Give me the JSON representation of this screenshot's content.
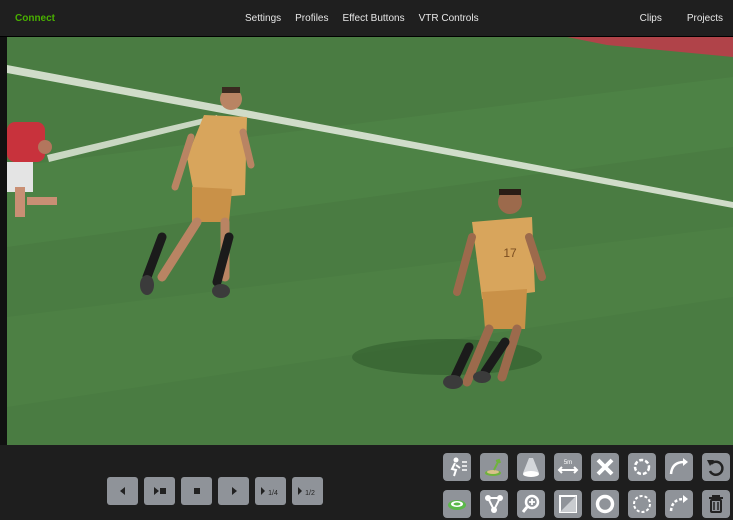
{
  "topbar": {
    "connect_label": "Connect",
    "menu": [
      "Settings",
      "Profiles",
      "Effect Buttons",
      "VTR Controls"
    ],
    "right_menu": [
      "Clips",
      "Projects"
    ]
  },
  "colors": {
    "connect": "#49b000",
    "topbar_bg": "#1f1f1f",
    "button_bg": "#8f9399",
    "pitch": "#4c7f44",
    "jersey": "#d8a55c"
  },
  "players": [
    {
      "number": "17"
    }
  ],
  "transport": {
    "buttons": [
      {
        "name": "step-back",
        "icon": "triangle-left"
      },
      {
        "name": "play-pause",
        "icon": "play-pause"
      },
      {
        "name": "stop",
        "icon": "square"
      },
      {
        "name": "play",
        "icon": "triangle-right"
      },
      {
        "name": "play-quarter-speed",
        "label": "1/4"
      },
      {
        "name": "play-half-speed",
        "label": "1/2"
      }
    ]
  },
  "effects": {
    "row1": [
      "player-cutout-icon",
      "spotlight-arrow-icon",
      "spotlight-cone-icon",
      "distance-arrow-icon",
      "x-marker-icon",
      "dashed-circle-icon",
      "curved-arrow-icon",
      "undo-icon"
    ],
    "row2": [
      "ring-marker-icon",
      "link-players-icon",
      "zoom-icon",
      "shade-area-icon",
      "solid-circle-icon",
      "dashed-ring-icon",
      "dashed-arrow-icon",
      "trash-icon"
    ],
    "distance_label": "5m"
  }
}
